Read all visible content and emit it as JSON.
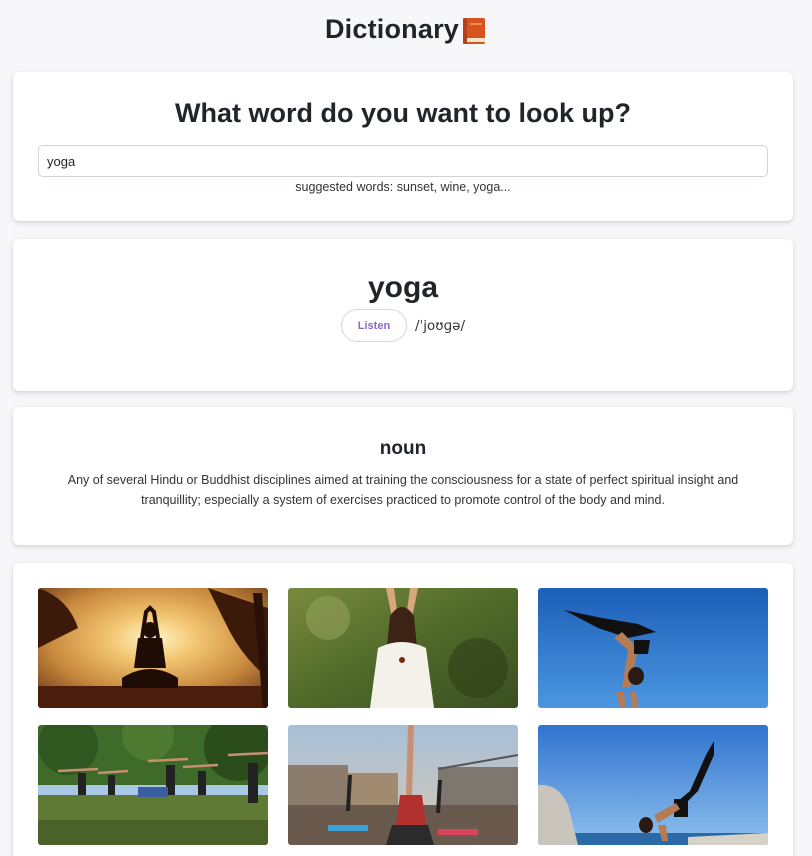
{
  "header": {
    "title": "Dictionary",
    "icon": "orange-book-icon"
  },
  "search": {
    "heading": "What word do you want to look up?",
    "value": "yoga",
    "suggestions": "suggested words: sunset, wine, yoga..."
  },
  "word": {
    "term": "yoga",
    "listen_label": "Listen",
    "phonetic": "/ˈjoʊɡə/"
  },
  "meaning": {
    "part_of_speech": "noun",
    "definition": "Any of several Hindu or Buddhist disciplines aimed at training the consciousness for a state of perfect spiritual insight and tranquillity; especially a system of exercises practiced to promote control of the body and mind."
  },
  "photos": [
    {
      "subject": "meditation silhouette at sunset"
    },
    {
      "subject": "woman in white dress with raised arms"
    },
    {
      "subject": "handstand against blue sky"
    },
    {
      "subject": "group outdoor yoga class"
    },
    {
      "subject": "group shoulder stand on rooftop"
    },
    {
      "subject": "arm balance pose on rocks"
    }
  ],
  "colors": {
    "accent": "#8b69c9",
    "background": "#f7f7fa",
    "card": "#ffffff"
  }
}
